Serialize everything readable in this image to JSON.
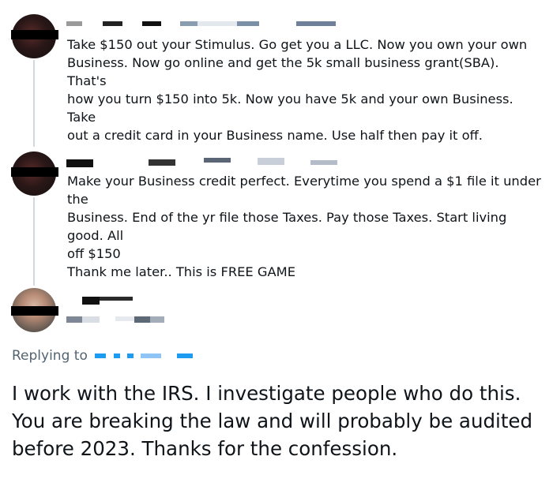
{
  "thread": [
    {
      "text": "Take $150 out your Stimulus. Go get you a LLC. Now you own your own\nBusiness. Now go online and get the 5k small business grant(SBA). That's\nhow you turn $150 into 5k. Now you have 5k and your own Business. Take\nout a credit card in your Business name. Use half then pay it off."
    },
    {
      "text": "Make your Business credit perfect. Everytime you spend a $1 file it under the\nBusiness. End of the yr file those Taxes. Pay those Taxes. Start living good. All\noff $150\nThank me later.. This is FREE GAME"
    }
  ],
  "reply": {
    "replying_to_label": "Replying to",
    "text": "I work with the IRS. I investigate people who do this.\nYou are breaking the law and will probably be audited\nbefore 2023. Thanks for the confession."
  },
  "colors": {
    "thread_line": "#cfd9de",
    "secondary_text": "#536471",
    "link_blue": "#1d9bf0",
    "censor": "#000000"
  }
}
